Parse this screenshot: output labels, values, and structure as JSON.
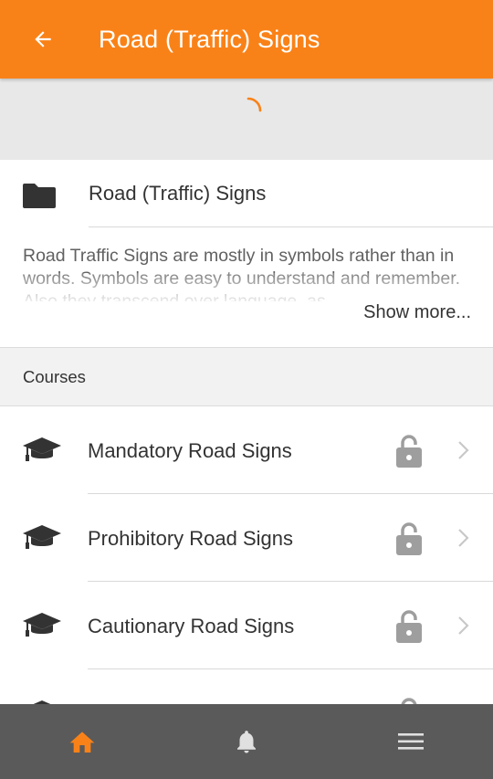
{
  "header": {
    "title": "Road (Traffic) Signs",
    "back_icon": "arrow-left-icon"
  },
  "loading": {
    "spinner_color": "#f98218"
  },
  "folder": {
    "icon": "folder-icon",
    "label": "Road (Traffic) Signs"
  },
  "description": {
    "text": "Road Traffic Signs are mostly in symbols rather than in words. Symbols are easy to understand and remember. Also they transcend over language, as",
    "show_more_label": "Show more..."
  },
  "courses_section": {
    "title": "Courses",
    "items": [
      {
        "label": "Mandatory Road Signs",
        "icon": "graduation-cap-icon",
        "locked": true
      },
      {
        "label": "Prohibitory Road Signs",
        "icon": "graduation-cap-icon",
        "locked": true
      },
      {
        "label": "Cautionary Road Signs",
        "icon": "graduation-cap-icon",
        "locked": true
      },
      {
        "label": "",
        "icon": "graduation-cap-icon",
        "locked": true
      }
    ]
  },
  "bottom_nav": {
    "tabs": [
      {
        "icon": "home-icon",
        "active": true
      },
      {
        "icon": "bell-icon",
        "active": false
      },
      {
        "icon": "menu-icon",
        "active": false
      }
    ]
  },
  "colors": {
    "primary": "#f98218",
    "bottom_nav_bg": "#5a5a5a",
    "icon_dark": "#333333",
    "lock_gray": "#9e9e9e"
  }
}
